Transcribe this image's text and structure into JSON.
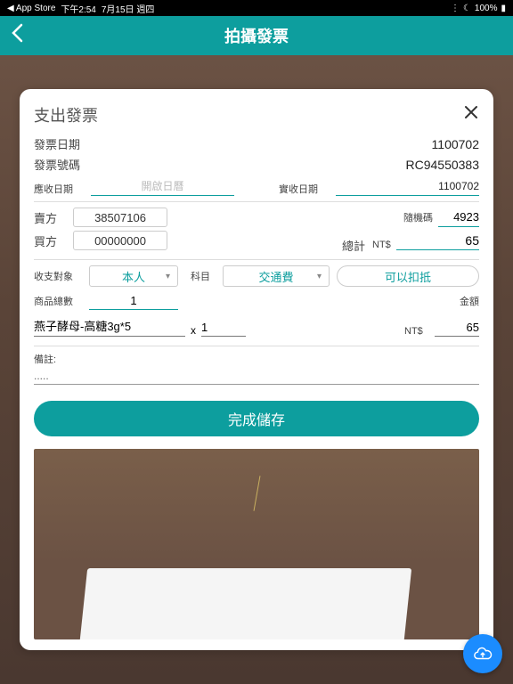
{
  "status": {
    "back_app": "App Store",
    "time": "下午2:54",
    "date": "7月15日 週四",
    "battery": "100%"
  },
  "nav": {
    "title": "拍攝發票"
  },
  "form": {
    "title": "支出發票",
    "date_label": "發票日期",
    "date_value": "1100702",
    "number_label": "發票號碼",
    "number_value": "RC94550383",
    "due_date_label": "應收日期",
    "due_date_placeholder": "開啟日曆",
    "receive_date_label": "實收日期",
    "receive_date_value": "1100702",
    "seller_label": "賣方",
    "seller_value": "38507106",
    "buyer_label": "買方",
    "buyer_value": "00000000",
    "random_label": "隨機碼",
    "random_value": "4923",
    "total_label": "總計",
    "currency": "NT$",
    "total_value": "65",
    "party_label": "收支對象",
    "party_value": "本人",
    "category_label": "科目",
    "category_value": "交通費",
    "deductible": "可以扣抵",
    "items_count_label": "商品總數",
    "items_count": "1",
    "amount_label": "金額",
    "item_name": "燕子酵母-高糖3g*5",
    "item_qty": "1",
    "item_amount": "65",
    "x": "x",
    "notes_label": "備註:",
    "notes_value": ".....",
    "save_btn": "完成儲存"
  }
}
